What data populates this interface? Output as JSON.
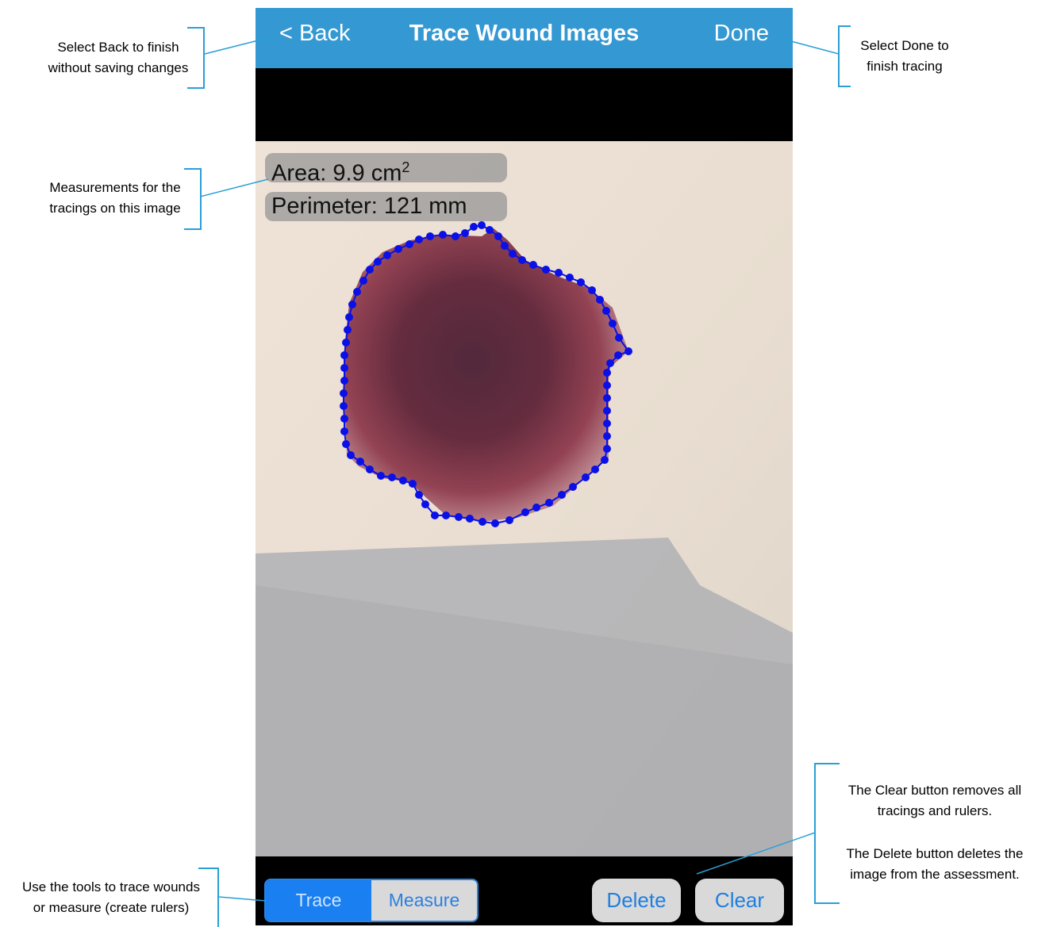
{
  "nav": {
    "back_label": "< Back",
    "title": "Trace Wound Images",
    "done_label": "Done"
  },
  "measurements": {
    "area_label": "Area: 9.9 cm",
    "area_superscript": "2",
    "perimeter_label": "Perimeter: 121 mm"
  },
  "toolbar": {
    "segments": [
      {
        "label": "Trace",
        "selected": true
      },
      {
        "label": "Measure",
        "selected": false
      }
    ],
    "delete_label": "Delete",
    "clear_label": "Clear"
  },
  "callouts": {
    "back_line1": "Select Back to finish",
    "back_line2": "without saving changes",
    "done_line1": "Select Done to",
    "done_line2": "finish tracing",
    "measure_line1": "Measurements for the",
    "measure_line2": "tracings on this image",
    "clear_line1": "The Clear button removes all",
    "clear_line2": "tracings and rulers.",
    "delete_line1": "The Delete button deletes the",
    "delete_line2": "image from the assessment.",
    "tools_line1": "Use the tools to trace wounds",
    "tools_line2": "or measure (create rulers)"
  },
  "colors": {
    "nav_bar": "#3498d3",
    "trace_line": "#0a10e6",
    "callout_line": "#2a9fd6",
    "button_text": "#1f7fe0"
  },
  "icons": {
    "back": "chevron-left-icon"
  }
}
